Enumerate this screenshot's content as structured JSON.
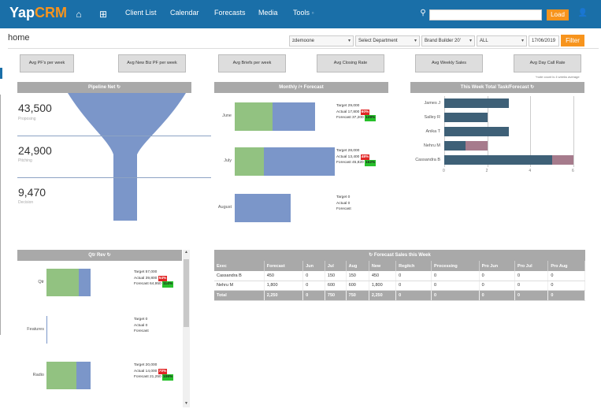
{
  "header": {
    "logo_main": "Yap",
    "logo_accent": "CRM",
    "nav": [
      "Client List",
      "Calendar",
      "Forecasts",
      "Media",
      "Tools"
    ],
    "tools_caret": "◦",
    "load_label": "Load",
    "search_value": ""
  },
  "page": {
    "title": "home",
    "filters": {
      "user": "zdemoone",
      "department": "Select Department",
      "brand": "Brand Builder 20'",
      "scope": "ALL",
      "date": "17/06/2019",
      "filter_label": "Filter"
    }
  },
  "kpis": [
    "Avg PF's per week",
    "Avg New Biz PF per week",
    "Avg Briefs per week",
    "Avg Closing Rate",
    "Avg Weekly Sales",
    "Avg Day Call Rate"
  ],
  "kpi_note": "*note count is 4 weeks average",
  "pipeline": {
    "title": "Pipeline Net",
    "stages": [
      {
        "value": "43,500",
        "label": "Proposing"
      },
      {
        "value": "24,900",
        "label": "Pitching"
      },
      {
        "value": "9,470",
        "label": "Decision"
      }
    ]
  },
  "monthly": {
    "title": "Monthly /+ Forecast",
    "months": [
      {
        "label": "June",
        "target": "Target 29,000",
        "actual": "Actual 17,800",
        "actual_pct": "60%",
        "forecast": "Forecast 37,200",
        "forecast_pct": "128%",
        "actual_frac": 0.38,
        "forecast_frac": 0.8
      },
      {
        "label": "July",
        "target": "Target 28,000",
        "actual": "Actual 13,400",
        "actual_pct": "48%",
        "forecast": "Forecast 45,820",
        "forecast_pct": "162%",
        "actual_frac": 0.29,
        "forecast_frac": 1.0
      },
      {
        "label": "August",
        "target": "Target 0",
        "actual": "Actual 0",
        "actual_pct": "",
        "forecast": "Forecast",
        "forecast_pct": "",
        "actual_frac": 0,
        "forecast_frac": 0.56
      }
    ]
  },
  "weekly": {
    "title": "This Week Total Task/Forecast",
    "ticks": [
      "0",
      "2",
      "4",
      "6"
    ],
    "max": 6,
    "rows": [
      {
        "name": "James J",
        "dark": 3,
        "pink": 0
      },
      {
        "name": "Salley R",
        "dark": 2,
        "pink": 0
      },
      {
        "name": "Anika T",
        "dark": 3,
        "pink": 0
      },
      {
        "name": "Nehru M",
        "dark": 1,
        "pink": 1
      },
      {
        "name": "Cassandra B",
        "dark": 5,
        "pink": 1
      }
    ]
  },
  "qtr": {
    "title": "Qtr Rev",
    "rows": [
      {
        "label": "Qtr",
        "target": "Target 57,000",
        "actual": "Actual 39,800",
        "actual_pct": "54%",
        "forecast": "Forecast 64,950",
        "forecast_pct": "114%",
        "g": 0.55,
        "b": 0.75
      },
      {
        "label": "Features",
        "target": "Target 0",
        "actual": "Actual 0",
        "actual_pct": "",
        "forecast": "Forecast",
        "forecast_pct": "",
        "g": 0.0,
        "b": 0.01
      },
      {
        "label": "Radio",
        "target": "Target 20,000",
        "actual": "Actual 14,000",
        "actual_pct": "70%",
        "forecast": "Forecast 21,250",
        "forecast_pct": "106%",
        "g": 0.5,
        "b": 0.75
      }
    ]
  },
  "forecast_table": {
    "title": "Forecast Sales this Week",
    "headers": [
      "Exec",
      "Forecast",
      "Jun",
      "Jul",
      "Aug",
      "New",
      "Regitch",
      "Processing",
      "Pro Jun",
      "Pro Jul",
      "Pro Aug"
    ],
    "rows": [
      [
        "Cassandra B",
        "450",
        "0",
        "150",
        "150",
        "450",
        "0",
        "0",
        "0",
        "0",
        "0"
      ],
      [
        "Nehru M",
        "1,800",
        "0",
        "600",
        "600",
        "1,800",
        "0",
        "0",
        "0",
        "0",
        "0"
      ]
    ],
    "total": [
      "Total",
      "2,250",
      "0",
      "750",
      "750",
      "2,250",
      "0",
      "0",
      "0",
      "0",
      "0"
    ]
  },
  "colors": {
    "topbar": "#1a6fa8",
    "accent": "#f7941d",
    "green": "#93c47d",
    "blue": "#7b96c9",
    "dark": "#3e6077",
    "pink": "#a67b8c",
    "red": "#e12626"
  }
}
